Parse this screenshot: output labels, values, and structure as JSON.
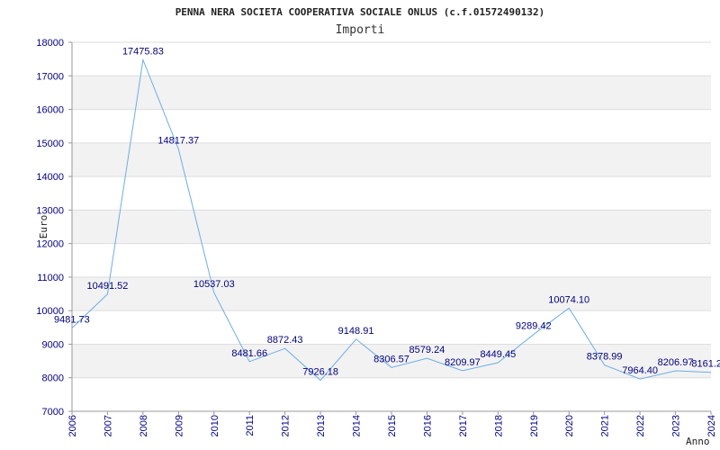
{
  "chart_data": {
    "type": "line",
    "title": "PENNA NERA SOCIETA COOPERATIVA SOCIALE ONLUS (c.f.01572490132)",
    "subtitle": "Importi",
    "xlabel": "Anno",
    "ylabel": "Euro",
    "ylim": [
      7000,
      18000
    ],
    "yticks": [
      7000,
      8000,
      9000,
      10000,
      11000,
      12000,
      13000,
      14000,
      15000,
      16000,
      17000,
      18000
    ],
    "grid": true,
    "x": [
      "2006",
      "2007",
      "2008",
      "2009",
      "2010",
      "2011",
      "2012",
      "2013",
      "2014",
      "2015",
      "2016",
      "2017",
      "2018",
      "2019",
      "2020",
      "2021",
      "2022",
      "2023",
      "2024"
    ],
    "values": [
      9481.73,
      10491.52,
      17475.83,
      14817.37,
      10537.03,
      8481.66,
      8872.43,
      7926.18,
      9148.91,
      8306.57,
      8579.24,
      8209.97,
      8449.45,
      9289.42,
      10074.1,
      8378.99,
      7964.4,
      8206.97,
      8161.2
    ],
    "labels": [
      "9481.73",
      "10491.52",
      "17475.83",
      "14817.37",
      "10537.03",
      "8481.66",
      "8872.43",
      "7926.18",
      "9148.91",
      "8306.57",
      "8579.24",
      "8209.97",
      "8449.45",
      "9289.42",
      "10074.10",
      "8378.99",
      "7964.40",
      "8206.97",
      "8161.2"
    ],
    "colors": {
      "line": "#6aaee8",
      "band": "#f2f2f2",
      "grid": "#dddddd",
      "axis": "#999999",
      "tick": "#00008b"
    }
  }
}
